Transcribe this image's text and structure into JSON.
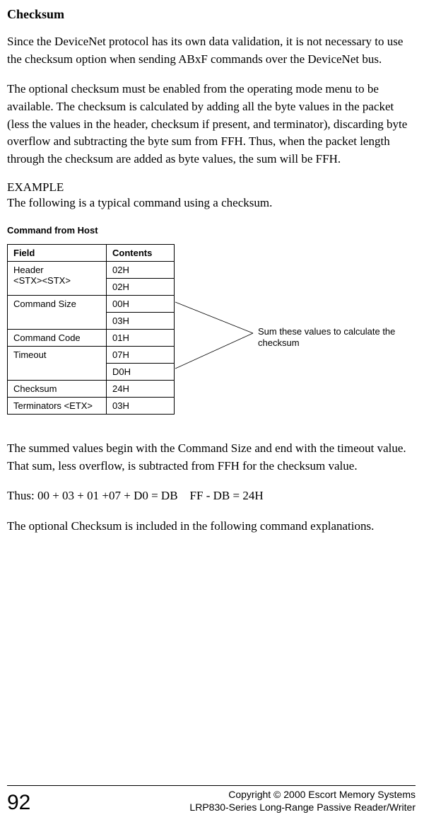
{
  "title": "Checksum",
  "para1": "Since the DeviceNet protocol has its own data validation, it is not necessary to use the checksum option when sending ABxF commands over the DeviceNet bus.",
  "para2": "The optional checksum must be enabled from the operating mode menu to be available. The checksum is calculated by adding all the byte values in the packet (less the values in the header, checksum if present, and terminator), discarding byte overflow and subtracting the byte sum from FFH. Thus, when the packet length through the checksum are added as byte values, the sum will be FFH.",
  "example_label": "EXAMPLE",
  "example_intro": "The following is a typical command using a checksum.",
  "table_caption": "Command from Host",
  "table": {
    "headers": {
      "field": "Field",
      "contents": "Contents"
    },
    "rows": [
      {
        "field": "Header\n<STX><STX>",
        "contents": "02H",
        "rowspan": 2
      },
      {
        "field": "",
        "contents": "02H"
      },
      {
        "field": "Command Size",
        "contents": "00H",
        "rowspan": 2
      },
      {
        "field": "",
        "contents": "03H"
      },
      {
        "field": "Command Code",
        "contents": "01H"
      },
      {
        "field": "Timeout",
        "contents": "07H",
        "rowspan": 2
      },
      {
        "field": "",
        "contents": "D0H"
      },
      {
        "field": "Checksum",
        "contents": "24H"
      },
      {
        "field": "Terminators <ETX>",
        "contents": "03H"
      }
    ]
  },
  "annotation": "Sum  these values to calculate the checksum",
  "para3": "The summed values begin with the Command Size and end with the timeout value. That sum, less overflow, is subtracted from FFH for the checksum value.",
  "para4": "Thus: 00 + 03 + 01 +07 + D0 = DB    FF - DB = 24H",
  "para5": "The optional Checksum is included in the following command explanations.",
  "footer": {
    "page_number": "92",
    "line1": "Copyright © 2000 Escort Memory Systems",
    "line2": "LRP830-Series Long-Range Passive Reader/Writer"
  },
  "chart_data": {
    "type": "table",
    "title": "Command from Host",
    "columns": [
      "Field",
      "Contents"
    ],
    "rows": [
      [
        "Header <STX><STX>",
        "02H"
      ],
      [
        "Header <STX><STX>",
        "02H"
      ],
      [
        "Command Size",
        "00H"
      ],
      [
        "Command Size",
        "03H"
      ],
      [
        "Command Code",
        "01H"
      ],
      [
        "Timeout",
        "07H"
      ],
      [
        "Timeout",
        "D0H"
      ],
      [
        "Checksum",
        "24H"
      ],
      [
        "Terminators <ETX>",
        "03H"
      ]
    ],
    "annotation": "Sum these values to calculate the checksum (rows Command Size through Timeout)"
  }
}
